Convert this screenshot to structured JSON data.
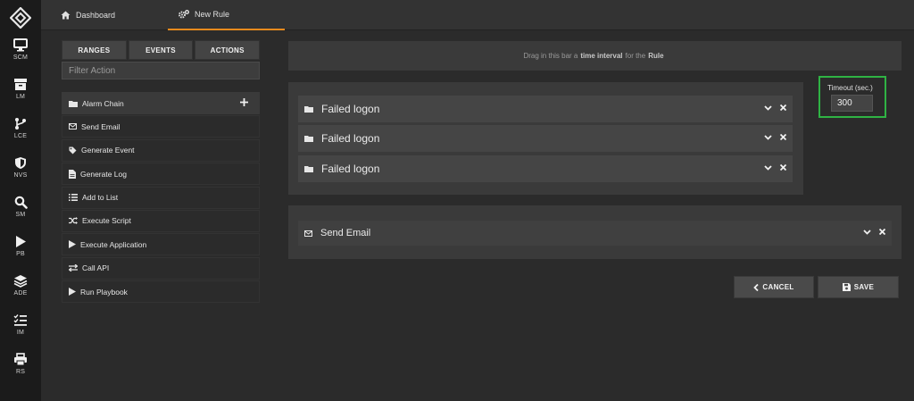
{
  "rail": [
    {
      "label": "SCM",
      "icon": "monitor-icon"
    },
    {
      "label": "LM",
      "icon": "archive-icon"
    },
    {
      "label": "LCE",
      "icon": "branch-icon"
    },
    {
      "label": "NVS",
      "icon": "shield-icon"
    },
    {
      "label": "SM",
      "icon": "search-icon"
    },
    {
      "label": "PB",
      "icon": "play-icon"
    },
    {
      "label": "ADE",
      "icon": "layers-icon"
    },
    {
      "label": "IM",
      "icon": "list-check-icon"
    },
    {
      "label": "RS",
      "icon": "printer-icon"
    }
  ],
  "tabs": {
    "dashboard": "Dashboard",
    "new_rule": "New Rule"
  },
  "subtabs": {
    "ranges": "RANGES",
    "events": "EVENTS",
    "actions": "ACTIONS"
  },
  "filter": {
    "placeholder": "Filter Action",
    "value": ""
  },
  "actions": [
    {
      "label": "Alarm Chain",
      "icon": "folder-icon"
    },
    {
      "label": "Send Email",
      "icon": "envelope-icon"
    },
    {
      "label": "Generate Event",
      "icon": "tag-icon"
    },
    {
      "label": "Generate Log",
      "icon": "file-icon"
    },
    {
      "label": "Add to List",
      "icon": "list-icon"
    },
    {
      "label": "Execute Script",
      "icon": "shuffle-icon"
    },
    {
      "label": "Execute Application",
      "icon": "play-icon"
    },
    {
      "label": "Call API",
      "icon": "exchange-icon"
    },
    {
      "label": "Run Playbook",
      "icon": "play-icon"
    }
  ],
  "interval_bar": {
    "prefix": "Drag in this bar a",
    "bold1": "time interval",
    "middle": "for the",
    "bold2": "Rule"
  },
  "rule_group": [
    {
      "label": "Failed logon"
    },
    {
      "label": "Failed logon"
    },
    {
      "label": "Failed logon"
    }
  ],
  "timeout": {
    "label": "Timeout (sec.)",
    "value": "300"
  },
  "email_action": {
    "label": "Send Email"
  },
  "buttons": {
    "cancel": "CANCEL",
    "save": "SAVE"
  },
  "colors": {
    "accent": "#e98a1c",
    "highlight": "#2fb344"
  }
}
